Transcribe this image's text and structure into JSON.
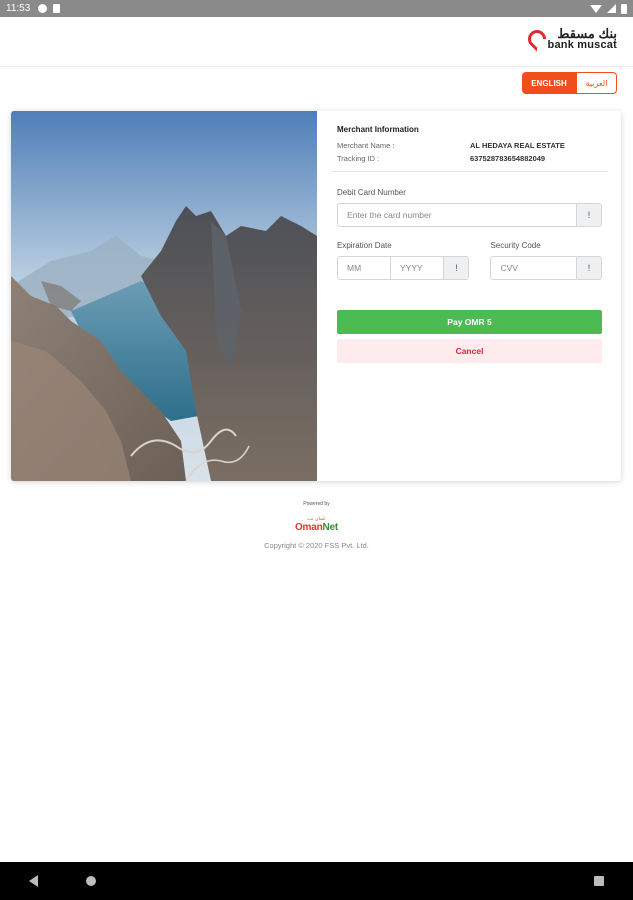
{
  "status_bar": {
    "time": "11:53"
  },
  "brand": {
    "name_ar": "بنك مسقط",
    "name_en": "bank muscat",
    "accent": "#e3262f"
  },
  "language": {
    "english_label": "ENGLISH",
    "arabic_label": "العربية",
    "active": "english",
    "accent": "#f04e1b"
  },
  "merchant": {
    "section_title": "Merchant Information",
    "name_label": "Merchant Name :",
    "name_value": "AL HEDAYA REAL ESTATE",
    "tracking_label": "Tracking ID :",
    "tracking_value": "637528783654882049"
  },
  "card_form": {
    "card_number_label": "Debit Card Number",
    "card_number_placeholder": "Enter the card number",
    "info_icon": "!",
    "expiry_label": "Expiration Date",
    "month_placeholder": "MM",
    "year_placeholder": "YYYY",
    "cvv_label": "Security Code",
    "cvv_placeholder": "CVV"
  },
  "actions": {
    "pay_label": "Pay OMR 5",
    "pay_color": "#4cbb54",
    "cancel_label": "Cancel",
    "cancel_color": "#d9283a"
  },
  "footer": {
    "powered_by": "Powered by",
    "network_ar": "عمان نت",
    "network_en_prefix": "Oman",
    "network_en_suffix": "Net",
    "copyright": "Copyright © 2020 FSS Pvt. Ltd."
  }
}
